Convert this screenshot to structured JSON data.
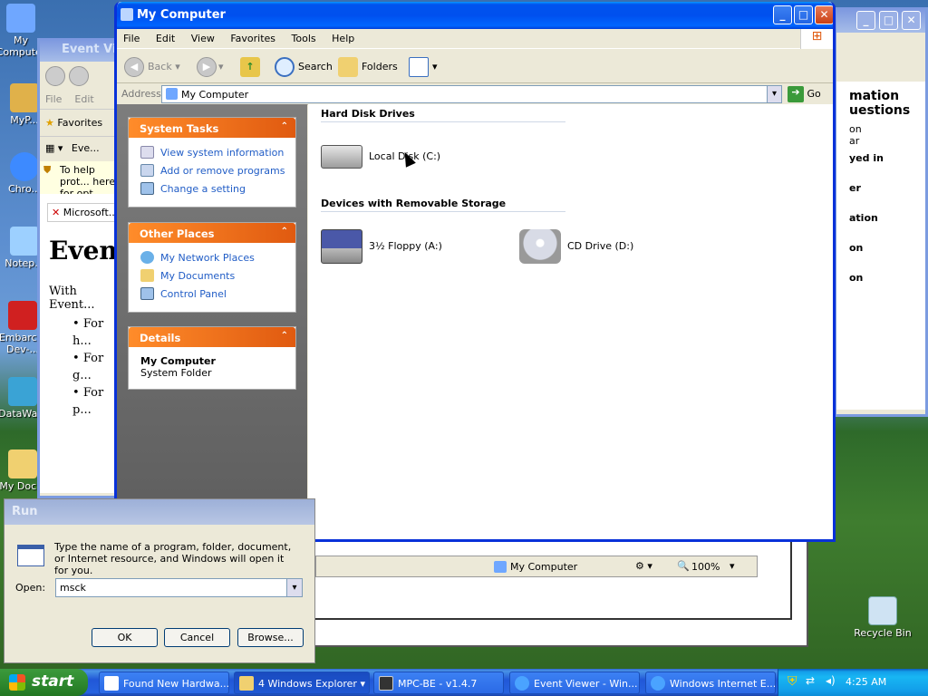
{
  "desktop": {
    "icons": [
      {
        "label": "My Computer",
        "icon": "my-computer-icon",
        "color": "#6fa7ff"
      },
      {
        "label": "MyP...",
        "icon": "my-pictures-icon",
        "color": "#e0b14a"
      },
      {
        "label": "Chro...",
        "icon": "chrome-icon",
        "color": "#3d8aff"
      },
      {
        "label": "Notep...",
        "icon": "notepad-icon",
        "color": "#9dd0ff"
      },
      {
        "label": "Embarc... Dev-...",
        "icon": "embarcadero-icon",
        "color": "#d02020"
      },
      {
        "label": "DataWa...",
        "icon": "datawarehouse-icon",
        "color": "#3aa3d5"
      },
      {
        "label": "My Doc...",
        "icon": "my-documents-icon",
        "color": "#f0d070"
      }
    ],
    "recycle_bin": "Recycle Bin"
  },
  "event_viewer_window": {
    "title": "Event Viewer",
    "menu": [
      "File",
      "Edit"
    ],
    "favorites": "Favorites",
    "tab": "Eve...",
    "infobar": "To help prot... here for opt...",
    "link_text": "Microsoft...",
    "heading": "Event...",
    "body_text": "With Event...",
    "bullets": [
      "For h...",
      "For g...",
      "For p..."
    ]
  },
  "back_ie_window": {
    "fragments": [
      "mation",
      "uestions",
      "on",
      "ar",
      "yed in",
      "er",
      "ation",
      "on",
      "on"
    ]
  },
  "my_computer_window": {
    "title": "My Computer",
    "menu": [
      "File",
      "Edit",
      "View",
      "Favorites",
      "Tools",
      "Help"
    ],
    "toolbar": {
      "back": "Back",
      "search": "Search",
      "folders": "Folders"
    },
    "address_label": "Address",
    "address_value": "My Computer",
    "go_label": "Go",
    "system_tasks": {
      "title": "System Tasks",
      "items": [
        "View system information",
        "Add or remove programs",
        "Change a setting"
      ]
    },
    "other_places": {
      "title": "Other Places",
      "items": [
        "My Network Places",
        "My Documents",
        "Control Panel"
      ]
    },
    "details": {
      "title": "Details",
      "name": "My Computer",
      "type": "System Folder"
    },
    "groups": {
      "hard_disks": "Hard Disk Drives",
      "removable": "Devices with Removable Storage"
    },
    "drives": {
      "local": "Local Disk (C:)",
      "floppy": "3½ Floppy (A:)",
      "cd": "CD Drive (D:)"
    }
  },
  "status_bar": {
    "location": "My Computer",
    "zoom": "100%"
  },
  "run_dialog": {
    "title": "Run",
    "description": "Type the name of a program, folder, document, or Internet resource, and Windows will open it for you.",
    "open_label": "Open:",
    "open_value": "msck",
    "ok": "OK",
    "cancel": "Cancel",
    "browse": "Browse..."
  },
  "taskbar": {
    "start": "start",
    "tasks": [
      {
        "label": "Found New Hardwa...",
        "icon": "hardware-wizard-icon"
      },
      {
        "label": "4 Windows Explorer",
        "icon": "folder-icon"
      },
      {
        "label": "MPC-BE - v1.4.7",
        "icon": "media-player-icon"
      },
      {
        "label": "Event Viewer - Win...",
        "icon": "ie-icon"
      },
      {
        "label": "Windows Internet E...",
        "icon": "ie-icon"
      }
    ],
    "clock": "4:25 AM"
  }
}
